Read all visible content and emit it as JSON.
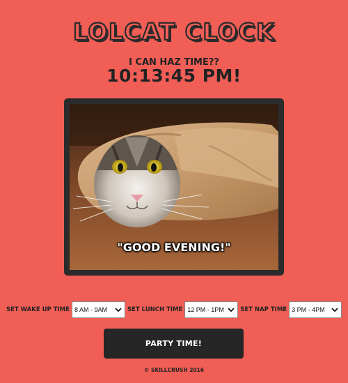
{
  "header": {
    "title": "LOLCAT CLOCK",
    "subtitle": "I CAN HAZ TIME??",
    "clock_time": "10:13:45 PM!"
  },
  "photo": {
    "caption": "\"GOOD EVENING!\""
  },
  "controls": {
    "wake_label": "SET WAKE UP TIME",
    "wake_value": "8 AM - 9AM",
    "lunch_label": "SET LUNCH TIME",
    "lunch_value": "12 PM - 1PM",
    "nap_label": "SET NAP TIME",
    "nap_value": "3 PM - 4PM"
  },
  "party_button": {
    "label": "PARTY TIME!"
  },
  "footer": {
    "text": "© SKILLCRUSH 2016"
  },
  "colors": {
    "background": "#f15e56",
    "dark": "#262626"
  }
}
